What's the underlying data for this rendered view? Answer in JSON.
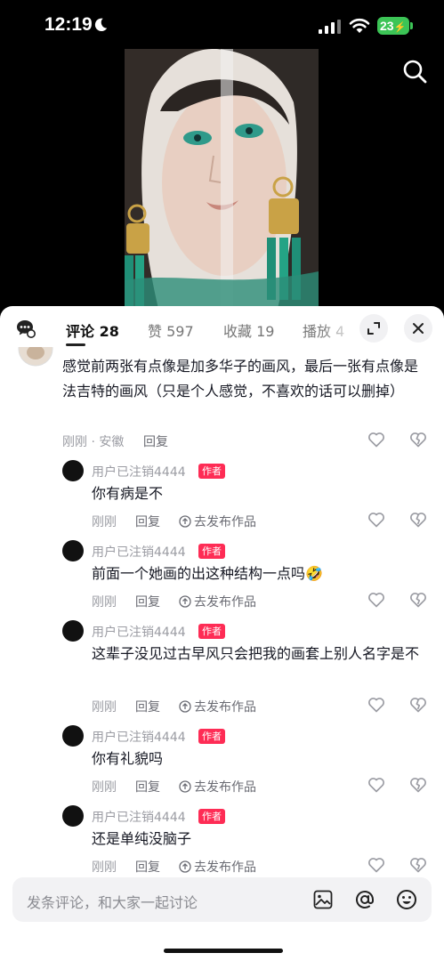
{
  "status_bar": {
    "time": "12:19",
    "battery": "23"
  },
  "tabs": [
    {
      "label": "评论 28",
      "active": true
    },
    {
      "label": "赞 597",
      "active": false
    },
    {
      "label": "收藏 19",
      "active": false
    },
    {
      "label": "播放 4",
      "active": false
    }
  ],
  "top_comment": {
    "text": "感觉前两张有点像是加多华子的画风，最后一张有点像是法吉特的画风（只是个人感觉，不喜欢的话可以删掉）",
    "meta": "刚刚 · 安徽",
    "reply": "回复"
  },
  "replies": [
    {
      "username": "用户已注销4444",
      "badge": "作者",
      "text": "你有病是不",
      "time": "刚刚",
      "reply": "回复",
      "publish": "去发布作品"
    },
    {
      "username": "用户已注销4444",
      "badge": "作者",
      "text": "前面一个她画的出这种结构一点吗🤣",
      "time": "刚刚",
      "reply": "回复",
      "publish": "去发布作品"
    },
    {
      "username": "用户已注销4444",
      "badge": "作者",
      "text": "这辈子没见过古早风只会把我的画套上别人名字是不",
      "time": "刚刚",
      "reply": "回复",
      "publish": "去发布作品"
    },
    {
      "username": "用户已注销4444",
      "badge": "作者",
      "text": "你有礼貌吗",
      "time": "刚刚",
      "reply": "回复",
      "publish": "去发布作品"
    },
    {
      "username": "用户已注销4444",
      "badge": "作者",
      "text": "还是单纯没脑子",
      "time": "刚刚",
      "reply": "回复",
      "publish": "去发布作品"
    }
  ],
  "composer": {
    "placeholder": "发条评论，和大家一起讨论"
  },
  "icons": {
    "status": [
      "moon-icon",
      "signal-icon",
      "wifi-icon",
      "battery-icon"
    ],
    "header": [
      "search-icon",
      "comment-bubble-icon",
      "expand-icon",
      "close-icon"
    ],
    "actions": [
      "heart-icon",
      "broken-heart-icon",
      "publish-arrow-icon"
    ],
    "composer": [
      "image-icon",
      "at-icon",
      "emoji-icon"
    ]
  },
  "colors": {
    "accent": "#fe2c55",
    "battery": "#3cc456"
  }
}
